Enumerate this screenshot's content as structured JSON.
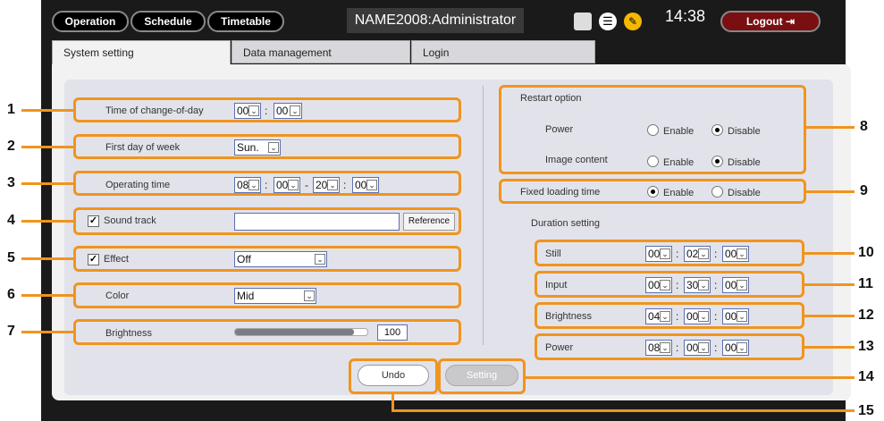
{
  "topbar": {
    "operation": "Operation",
    "schedule": "Schedule",
    "timetable": "Timetable",
    "title": "NAME2008:Administrator",
    "clock": "14:38",
    "logout": "Logout"
  },
  "tabs": [
    "System setting",
    "Data management",
    "Login"
  ],
  "left": {
    "change_of_day": {
      "label": "Time of change-of-day",
      "h": "00",
      "m": "00"
    },
    "first_day": {
      "label": "First day of week",
      "value": "Sun."
    },
    "operating": {
      "label": "Operating time",
      "h1": "08",
      "m1": "00",
      "h2": "20",
      "m2": "00"
    },
    "sound": {
      "label": "Sound track",
      "checked": true,
      "value": "",
      "reference": "Reference"
    },
    "effect": {
      "label": "Effect",
      "checked": true,
      "value": "Off"
    },
    "color": {
      "label": "Color",
      "value": "Mid"
    },
    "brightness": {
      "label": "Brightness",
      "value": "100",
      "level_pct": 100
    }
  },
  "right": {
    "restart": {
      "label": "Restart option",
      "power": "Power",
      "image": "Image content",
      "enable": "Enable",
      "disable": "Disable"
    },
    "fixed": {
      "label": "Fixed loading time",
      "enable": "Enable",
      "disable": "Disable"
    },
    "duration_label": "Duration setting",
    "still": {
      "label": "Still",
      "h": "00",
      "m": "02",
      "s": "00"
    },
    "input": {
      "label": "Input",
      "h": "00",
      "m": "30",
      "s": "00"
    },
    "brightness": {
      "label": "Brightness",
      "h": "04",
      "m": "00",
      "s": "00"
    },
    "power": {
      "label": "Power",
      "h": "08",
      "m": "00",
      "s": "00"
    }
  },
  "buttons": {
    "undo": "Undo",
    "setting": "Setting"
  },
  "callouts": [
    "1",
    "2",
    "3",
    "4",
    "5",
    "6",
    "7",
    "8",
    "9",
    "10",
    "11",
    "12",
    "13",
    "14",
    "15"
  ],
  "colors": {
    "highlight": "#f0941e",
    "logout": "#7a0f12"
  }
}
